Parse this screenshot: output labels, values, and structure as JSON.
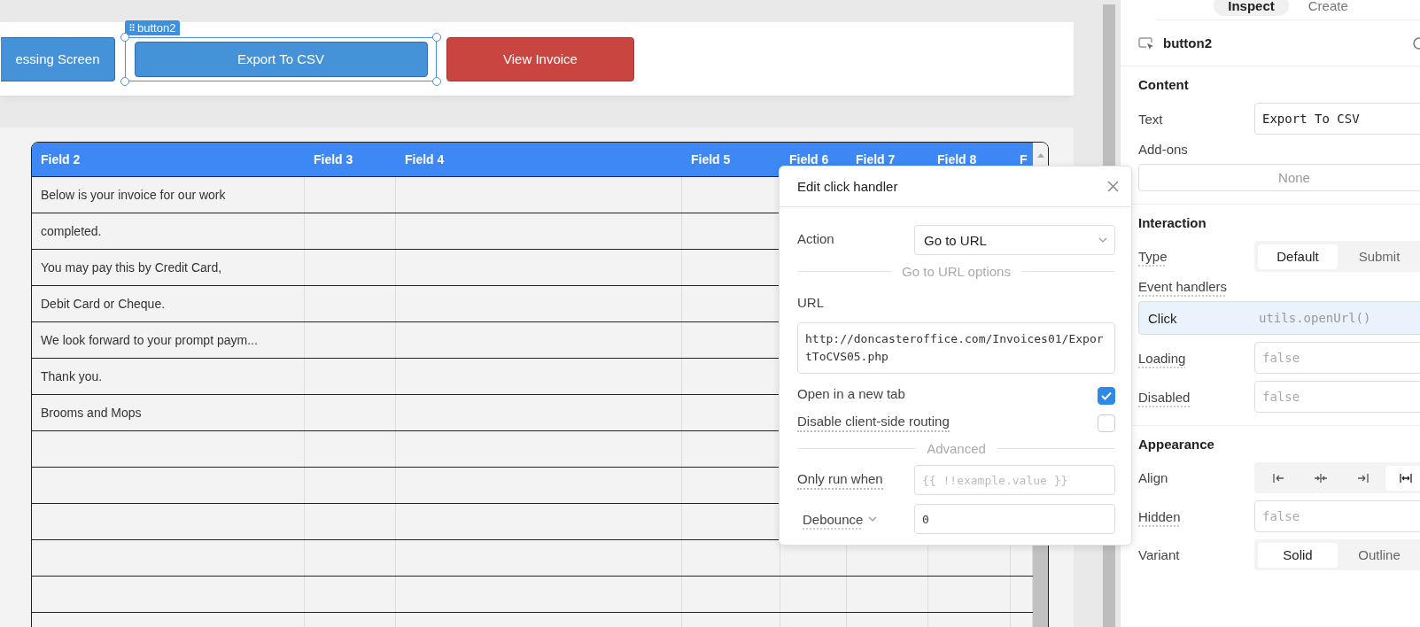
{
  "canvas": {
    "selection_tag": "button2",
    "buttons": [
      {
        "label": "essing Screen",
        "kind": "primary",
        "selected": false
      },
      {
        "label": "Export To CSV",
        "kind": "primary",
        "selected": true
      },
      {
        "label": "View Invoice",
        "kind": "danger",
        "selected": false
      }
    ],
    "table": {
      "columns": [
        "Field 2",
        "Field 3",
        "Field 4",
        "Field 5",
        "Field 6",
        "Field 7",
        "Field 8",
        "F"
      ],
      "rows": [
        {
          "field_2": "Below is your invoice for our work"
        },
        {
          "field_2": "completed."
        },
        {
          "field_2": "You may pay this by Credit Card,"
        },
        {
          "field_2": "Debit Card or Cheque."
        },
        {
          "field_2": "We look forward to your prompt paym..."
        },
        {
          "field_2": "Thank you."
        },
        {
          "field_2": "Brooms and Mops"
        }
      ]
    }
  },
  "click_handler_popover": {
    "title": "Edit click handler",
    "action_label": "Action",
    "action_value": "Go to URL",
    "options_divider": "Go to URL options",
    "url_label": "URL",
    "url_value": "http://doncasteroffice.com/Invoices01/ExportToCVS05.php",
    "options": [
      {
        "label": "Open in a new tab",
        "checked": true,
        "dotted": false
      },
      {
        "label": "Disable client-side routing",
        "checked": false,
        "dotted": true
      }
    ],
    "advanced_divider": "Advanced",
    "only_run_when": {
      "label": "Only run when",
      "placeholder": "{{ !!example.value }}"
    },
    "debounce": {
      "label": "Debounce",
      "value": "0"
    }
  },
  "inspector": {
    "tabs": [
      {
        "label": "Inspect",
        "selected": true
      },
      {
        "label": "Create",
        "selected": false
      }
    ],
    "component_name": "button2",
    "content": {
      "title": "Content",
      "text_label": "Text",
      "text_value": "Export To CSV",
      "addons_label": "Add-ons",
      "addons_value": "None"
    },
    "interaction": {
      "title": "Interaction",
      "type_label": "Type",
      "type_options": [
        {
          "label": "Default",
          "selected": true
        },
        {
          "label": "Submit",
          "selected": false
        }
      ],
      "event_handlers_label": "Event handlers",
      "handlers": [
        {
          "event": "Click",
          "action": "utils.openUrl()"
        }
      ],
      "loading": {
        "label": "Loading",
        "placeholder": "false"
      },
      "disabled": {
        "label": "Disabled",
        "placeholder": "false"
      }
    },
    "appearance": {
      "title": "Appearance",
      "align_label": "Align",
      "align_options": [
        {
          "kind": "left",
          "selected": false
        },
        {
          "kind": "center",
          "selected": false
        },
        {
          "kind": "right",
          "selected": false
        },
        {
          "kind": "stretch",
          "selected": true
        }
      ],
      "hidden": {
        "label": "Hidden",
        "placeholder": "false"
      },
      "variant_label": "Variant",
      "variant_options": [
        {
          "label": "Solid",
          "selected": true
        },
        {
          "label": "Outline",
          "selected": false
        }
      ]
    }
  }
}
